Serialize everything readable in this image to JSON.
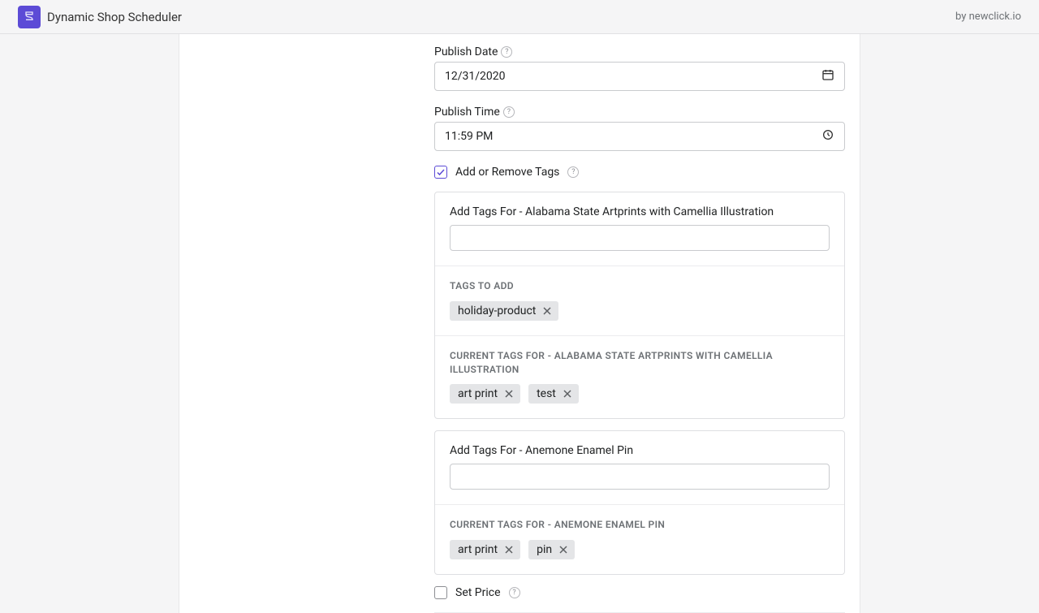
{
  "header": {
    "app_name": "Dynamic Shop Scheduler",
    "byline": "by newclick.io"
  },
  "publish_date": {
    "label": "Publish Date",
    "value": "12/31/2020"
  },
  "publish_time": {
    "label": "Publish Time",
    "value": "11:59 PM"
  },
  "tags_toggle": {
    "label": "Add or Remove Tags",
    "checked": true
  },
  "products": [
    {
      "add_label": "Add Tags For - Alabama State Artprints with Camellia Illustration",
      "tags_to_add_heading": "TAGS TO ADD",
      "tags_to_add": [
        "holiday-product"
      ],
      "current_heading": "CURRENT TAGS FOR - ALABAMA STATE ARTPRINTS WITH CAMELLIA ILLUSTRATION",
      "current_tags": [
        "art print",
        "test"
      ]
    },
    {
      "add_label": "Add Tags For - Anemone Enamel Pin",
      "tags_to_add_heading": "",
      "tags_to_add": [],
      "current_heading": "CURRENT TAGS FOR - ANEMONE ENAMEL PIN",
      "current_tags": [
        "art print",
        "pin"
      ]
    }
  ],
  "set_price": {
    "label": "Set Price",
    "checked": false
  }
}
